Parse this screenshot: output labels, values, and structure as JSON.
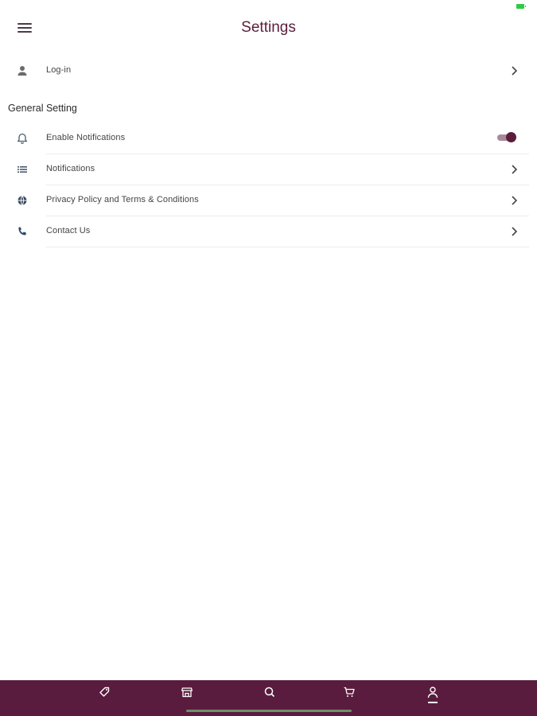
{
  "app_bar": {
    "title": "Settings",
    "menu_icon": "hamburger-menu-icon"
  },
  "account": {
    "login": {
      "label": "Log-in",
      "icon": "person-icon"
    }
  },
  "general": {
    "header": "General Setting",
    "items": [
      {
        "label": "Enable Notifications",
        "icon": "bell-icon",
        "control": "toggle",
        "toggle_on": true
      },
      {
        "label": "Notifications",
        "icon": "list-icon",
        "control": "chevron"
      },
      {
        "label": "Privacy Policy and Terms & Conditions",
        "icon": "globe-icon",
        "control": "chevron"
      },
      {
        "label": "Contact Us",
        "icon": "phone-icon",
        "control": "chevron"
      }
    ]
  },
  "bottom_nav": {
    "items": [
      {
        "icon": "tag-icon"
      },
      {
        "icon": "store-icon"
      },
      {
        "icon": "search-icon"
      },
      {
        "icon": "cart-icon"
      },
      {
        "icon": "profile-icon",
        "active": true
      }
    ]
  },
  "colors": {
    "brand": "#5c1d3c",
    "nav_background": "#5a1c3e",
    "toggle_track": "#a8899a",
    "battery": "#2ecc40"
  }
}
